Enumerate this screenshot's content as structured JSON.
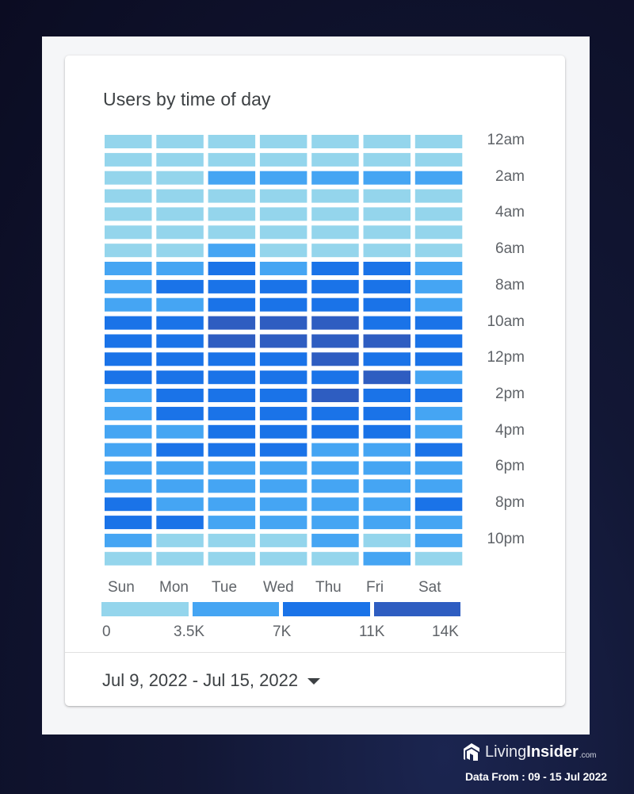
{
  "card": {
    "title": "Users by time of day",
    "date_range": "Jul 9, 2022 - Jul 15, 2022"
  },
  "branding": {
    "logo_icon": "house-logo-icon",
    "name_part1": "Living",
    "name_part2": "Insider",
    "suffix": ".com",
    "source_note": "Data From : 09 - 15 Jul 2022"
  },
  "colors": {
    "bucket_1": "#94d5ec",
    "bucket_2": "#45a5f3",
    "bucket_3": "#1a73e8",
    "bucket_4": "#2e5dc1"
  },
  "chart_data": {
    "type": "heatmap",
    "title": "Users by time of day",
    "xlabel": "",
    "ylabel": "",
    "x_categories": [
      "Sun",
      "Mon",
      "Tue",
      "Wed",
      "Thu",
      "Fri",
      "Sat"
    ],
    "y_categories": [
      "12am",
      "1am",
      "2am",
      "3am",
      "4am",
      "5am",
      "6am",
      "7am",
      "8am",
      "9am",
      "10am",
      "11am",
      "12pm",
      "1pm",
      "2pm",
      "3pm",
      "4pm",
      "5pm",
      "6pm",
      "7pm",
      "8pm",
      "9pm",
      "10pm",
      "11pm"
    ],
    "y_tick_labels": [
      "12am",
      "2am",
      "4am",
      "6am",
      "8am",
      "10am",
      "12pm",
      "2pm",
      "4pm",
      "6pm",
      "8pm",
      "10pm"
    ],
    "legend": {
      "placement": "bottom",
      "tick_labels": [
        "0",
        "3.5K",
        "7K",
        "11K",
        "14K"
      ],
      "thresholds": [
        0,
        3500,
        7000,
        11000,
        14000
      ],
      "buckets": [
        {
          "range": "0 - 3.5K",
          "color": "#94d5ec"
        },
        {
          "range": "3.5K - 7K",
          "color": "#45a5f3"
        },
        {
          "range": "7K - 11K",
          "color": "#1a73e8"
        },
        {
          "range": "11K - 14K",
          "color": "#2e5dc1"
        }
      ]
    },
    "value_note": "bucket index per cell (1 = 0-3.5K, 2 = 3.5K-7K, 3 = 7K-11K, 4 = 11K-14K); rows = hour, columns = day",
    "buckets_by_hour": [
      [
        1,
        1,
        1,
        1,
        1,
        1,
        1
      ],
      [
        1,
        1,
        1,
        1,
        1,
        1,
        1
      ],
      [
        1,
        1,
        2,
        2,
        2,
        2,
        2
      ],
      [
        1,
        1,
        1,
        1,
        1,
        1,
        1
      ],
      [
        1,
        1,
        1,
        1,
        1,
        1,
        1
      ],
      [
        1,
        1,
        1,
        1,
        1,
        1,
        1
      ],
      [
        1,
        1,
        2,
        1,
        1,
        1,
        1
      ],
      [
        2,
        2,
        3,
        2,
        3,
        3,
        2
      ],
      [
        2,
        3,
        3,
        3,
        3,
        3,
        2
      ],
      [
        2,
        2,
        3,
        3,
        3,
        3,
        2
      ],
      [
        3,
        3,
        4,
        4,
        4,
        3,
        3
      ],
      [
        3,
        3,
        4,
        4,
        4,
        4,
        3
      ],
      [
        3,
        3,
        3,
        3,
        4,
        3,
        3
      ],
      [
        3,
        3,
        3,
        3,
        3,
        4,
        2
      ],
      [
        2,
        3,
        3,
        3,
        4,
        3,
        3
      ],
      [
        2,
        3,
        3,
        3,
        3,
        3,
        2
      ],
      [
        2,
        2,
        3,
        3,
        3,
        3,
        2
      ],
      [
        2,
        3,
        3,
        3,
        2,
        2,
        3
      ],
      [
        2,
        2,
        2,
        2,
        2,
        2,
        2
      ],
      [
        2,
        2,
        2,
        2,
        2,
        2,
        2
      ],
      [
        3,
        2,
        2,
        2,
        2,
        2,
        3
      ],
      [
        3,
        3,
        2,
        2,
        2,
        2,
        2
      ],
      [
        2,
        1,
        1,
        1,
        2,
        1,
        2
      ],
      [
        1,
        1,
        1,
        1,
        1,
        2,
        1
      ]
    ]
  }
}
